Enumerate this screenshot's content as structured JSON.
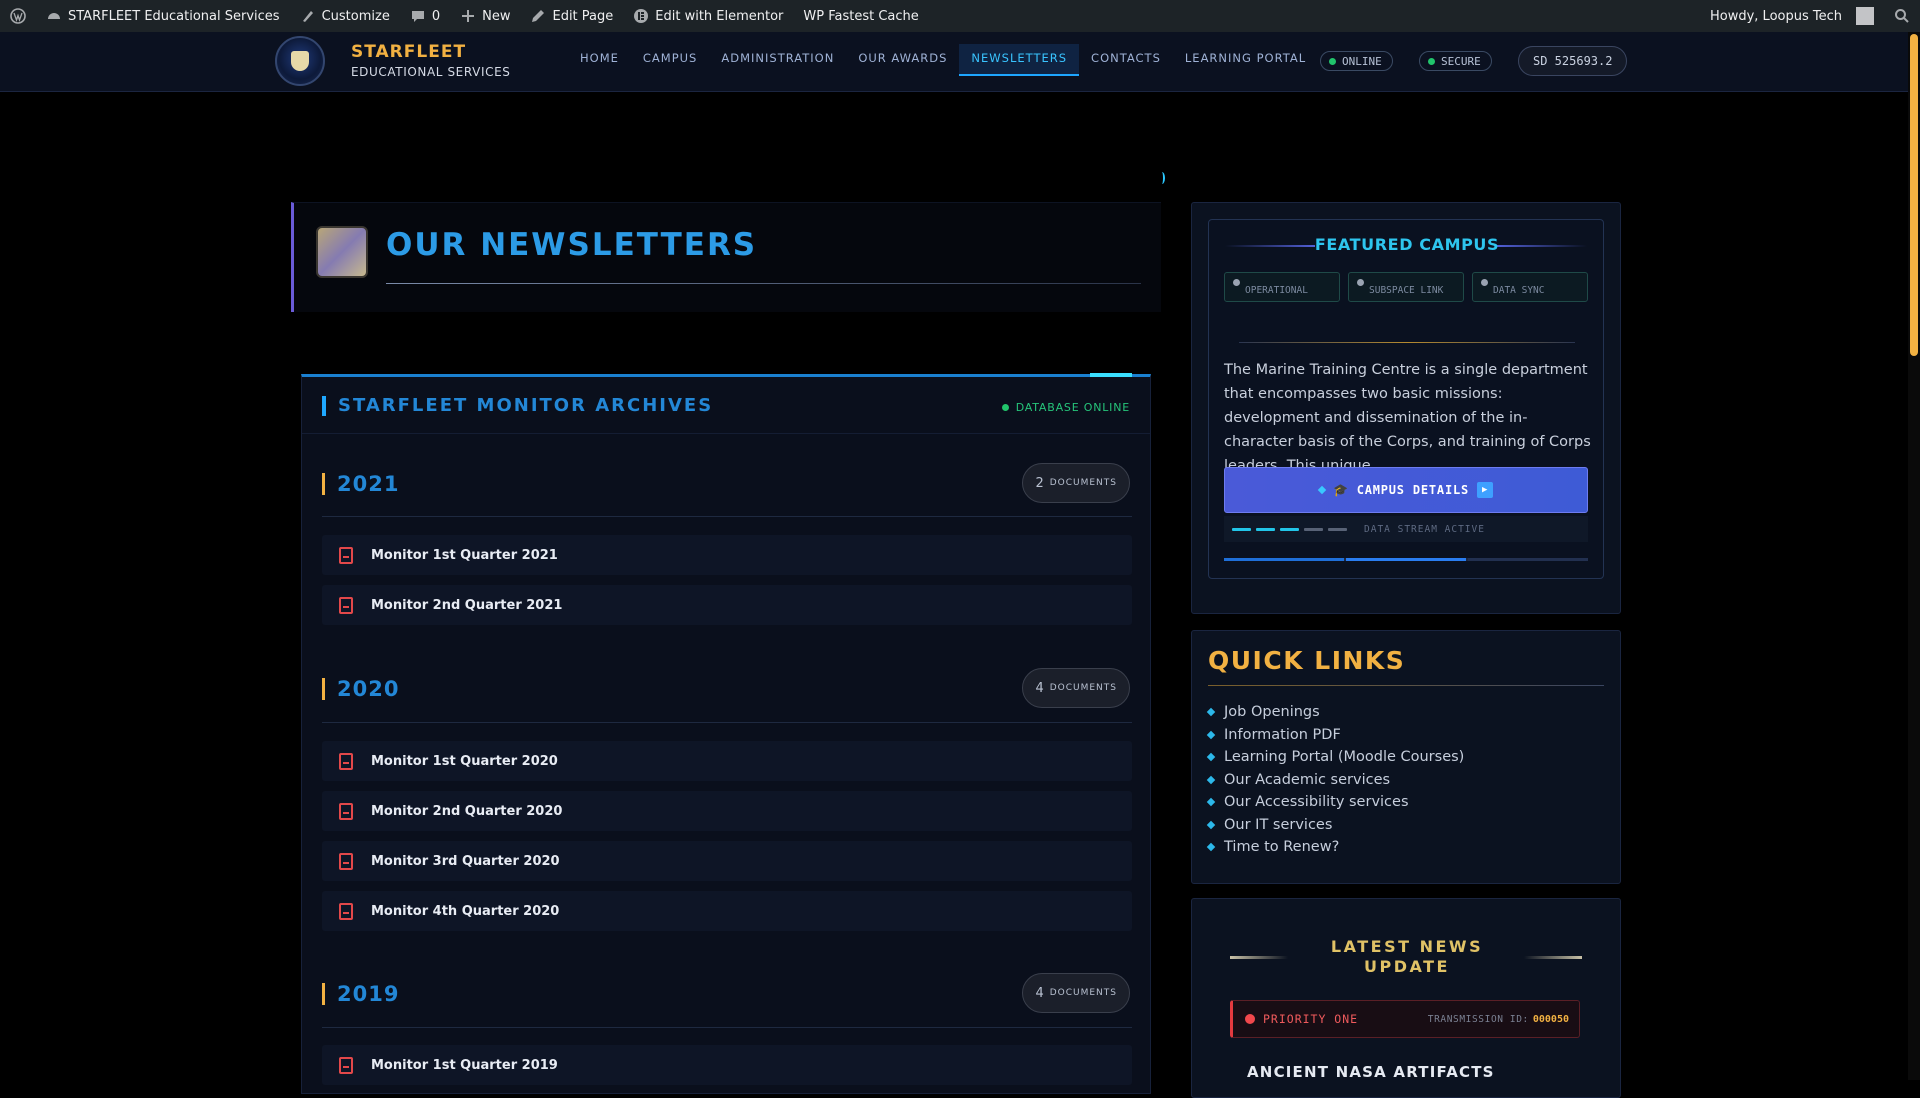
{
  "adminbar": {
    "site_name": "STARFLEET Educational Services",
    "customize": "Customize",
    "comments_count": "0",
    "new": "New",
    "edit_page": "Edit Page",
    "edit_elementor": "Edit with Elementor",
    "cache": "WP Fastest Cache",
    "howdy": "Howdy, Loopus Tech"
  },
  "header": {
    "brand_line1": "STARFLEET",
    "brand_line2": "EDUCATIONAL SERVICES",
    "nav": [
      "HOME",
      "CAMPUS",
      "ADMINISTRATION",
      "OUR AWARDS",
      "NEWSLETTERS",
      "CONTACTS",
      "LEARNING PORTAL"
    ],
    "active_nav": "NEWSLETTERS",
    "status_online": "ONLINE",
    "status_secure": "SECURE",
    "stardate": "SD 525693.2"
  },
  "page": {
    "title": "OUR NEWSLETTERS"
  },
  "archive": {
    "heading": "STARFLEET MONITOR ARCHIVES",
    "db_status": "DATABASE ONLINE",
    "docs_label": "DOCUMENTS",
    "years": [
      {
        "year": "2021",
        "count": "2",
        "docs": [
          "Monitor 1st Quarter 2021",
          "Monitor 2nd Quarter 2021"
        ]
      },
      {
        "year": "2020",
        "count": "4",
        "docs": [
          "Monitor 1st Quarter 2020",
          "Monitor 2nd Quarter 2020",
          "Monitor 3rd Quarter 2020",
          "Monitor 4th Quarter 2020"
        ]
      },
      {
        "year": "2019",
        "count": "4",
        "docs": [
          "Monitor 1st Quarter 2019"
        ]
      }
    ]
  },
  "featured": {
    "title": "FEATURED CAMPUS",
    "chips": [
      "OPERATIONAL",
      "SUBSPACE LINK",
      "DATA SYNC"
    ],
    "description": "The Marine Training Centre is a single department that encompasses two basic missions: development and dissemination of the in-character basis of the Corps, and training of Corps leaders. This unique...",
    "button": "CAMPUS DETAILS",
    "stream_label": "DATA STREAM ACTIVE"
  },
  "quick_links": {
    "title": "QUICK LINKS",
    "items": [
      "Job Openings",
      "Information PDF",
      "Learning Portal (Moodle Courses)",
      "Our Academic services",
      "Our Accessibility services",
      "Our IT services",
      "Time to Renew?"
    ]
  },
  "news": {
    "title": "LATEST NEWS UPDATE",
    "priority": "PRIORITY ONE",
    "transmission_label": "TRANSMISSION ID:",
    "transmission_id": "000050",
    "headline": "ANCIENT NASA ARTIFACTS"
  },
  "colors": {
    "accent_gold": "#f2b142",
    "accent_blue": "#2387d6",
    "accent_cyan": "#2ec5ee",
    "alert_red": "#e33a3f",
    "online_green": "#21c46b"
  }
}
